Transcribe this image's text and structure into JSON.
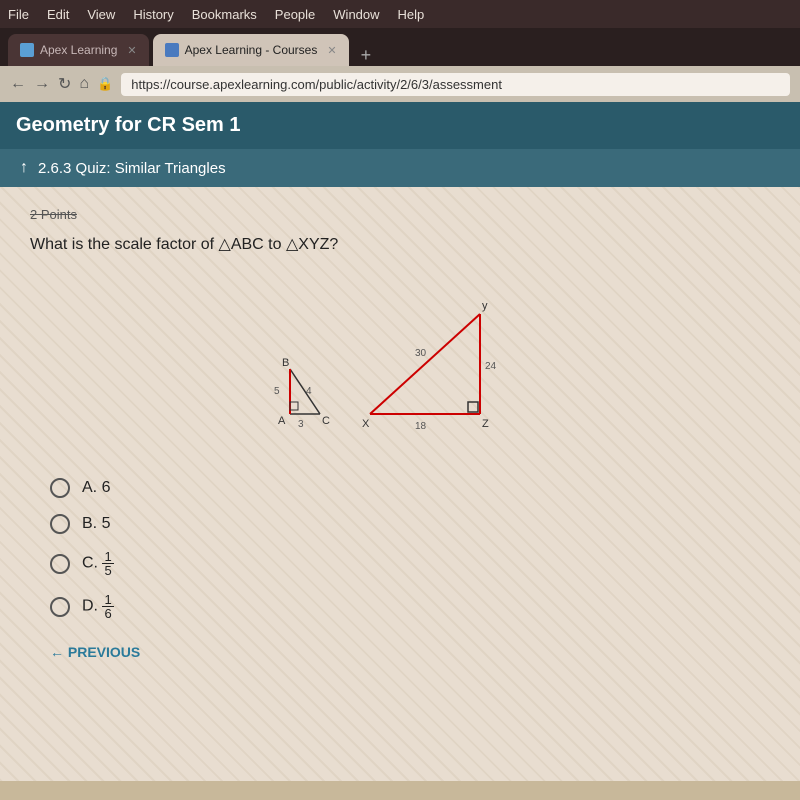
{
  "menubar": {
    "items": [
      "File",
      "Edit",
      "View",
      "History",
      "Bookmarks",
      "People",
      "Window",
      "Help"
    ]
  },
  "tabs": [
    {
      "label": "Apex Learning",
      "active": false,
      "closeable": true
    },
    {
      "label": "Apex Learning - Courses",
      "active": true,
      "closeable": true
    }
  ],
  "tab_new_label": "+",
  "address": {
    "url": "https://course.apexlearning.com/public/activity/2/6/3/assessment"
  },
  "course": {
    "title": "Geometry for CR Sem 1"
  },
  "quiz": {
    "title": "2.6.3 Quiz:  Similar Triangles"
  },
  "question": {
    "points": "2 Points",
    "text": "What is the scale factor of △ABC to △XYZ?",
    "diagram": {
      "small_triangle": {
        "label_b": "B",
        "label_a": "A",
        "label_c": "C",
        "side_ac": "3",
        "side_ab": "5",
        "side_bc": "4"
      },
      "large_triangle": {
        "label_y": "y",
        "label_x": "X",
        "label_z": "Z",
        "side_xz": "18",
        "side_yz": "24",
        "side_xy": "30"
      }
    },
    "choices": [
      {
        "letter": "A",
        "value": "6",
        "type": "plain"
      },
      {
        "letter": "B",
        "value": "5",
        "type": "plain"
      },
      {
        "letter": "C",
        "numerator": "1",
        "denominator": "5",
        "type": "fraction"
      },
      {
        "letter": "D",
        "numerator": "1",
        "denominator": "6",
        "type": "fraction"
      }
    ]
  },
  "navigation": {
    "previous_label": "← PREVIOUS"
  }
}
